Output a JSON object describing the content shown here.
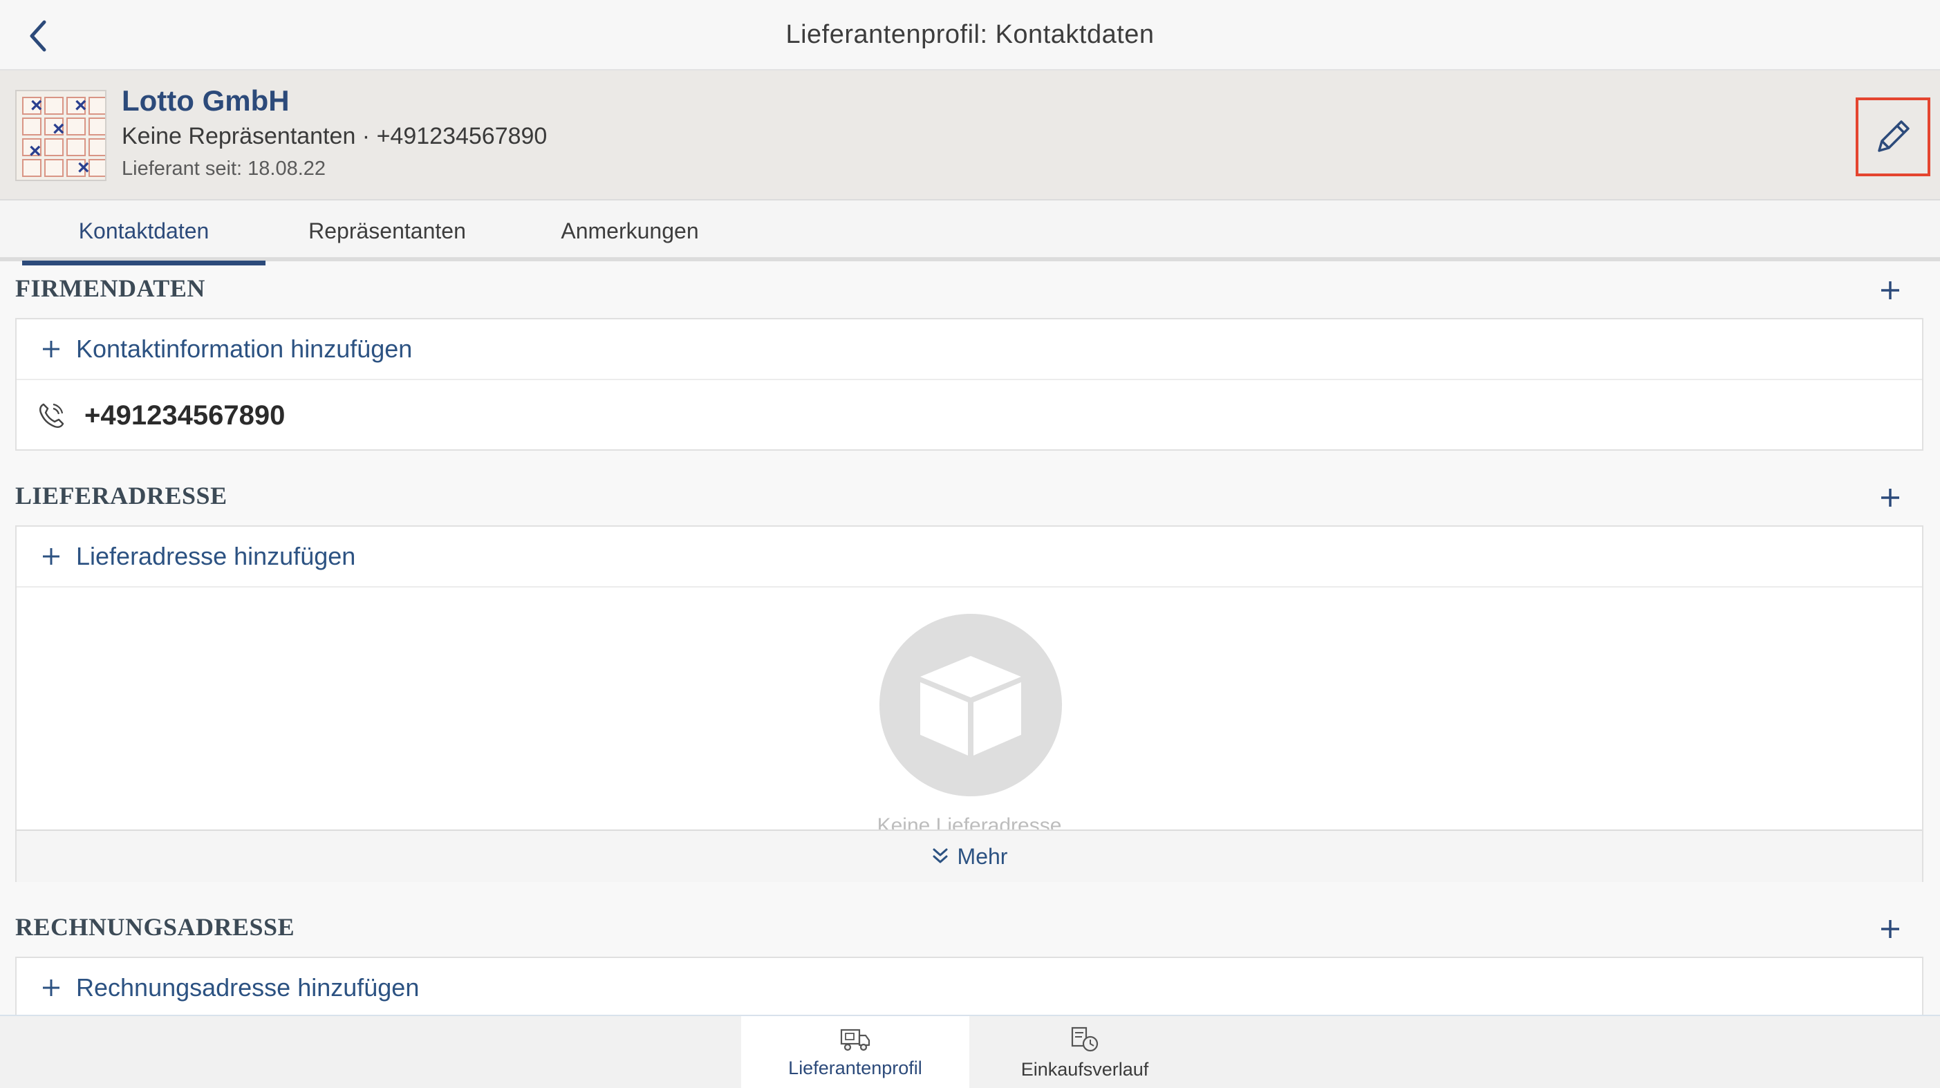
{
  "header": {
    "title": "Lieferantenprofil: Kontaktdaten",
    "back_icon": "chevron-left-icon"
  },
  "profile": {
    "name": "Lotto GmbH",
    "subtitle": "Keine Repräsentanten · +491234567890",
    "since": "Lieferant seit: 18.08.22",
    "edit_icon": "pencil-icon"
  },
  "tabs": [
    {
      "label": "Kontaktdaten",
      "active": true
    },
    {
      "label": "Repräsentanten",
      "active": false
    },
    {
      "label": "Anmerkungen",
      "active": false
    }
  ],
  "sections": {
    "firmendaten": {
      "title": "FIRMENDATEN",
      "add_label": "Kontaktinformation hinzufügen",
      "phone": "+491234567890"
    },
    "lieferadresse": {
      "title": "LIEFERADRESSE",
      "add_label": "Lieferadresse hinzufügen",
      "empty_text": "Keine Lieferadresse",
      "more_label": "Mehr"
    },
    "rechnungsadresse": {
      "title": "RECHNUNGSADRESSE",
      "add_label": "Rechnungsadresse hinzufügen"
    }
  },
  "bottom_nav": [
    {
      "label": "Lieferantenprofil",
      "icon": "supplier-truck-icon",
      "active": true
    },
    {
      "label": "Einkaufsverlauf",
      "icon": "purchase-history-icon",
      "active": false
    }
  ],
  "colors": {
    "accent": "#2c4a7a",
    "link": "#2c5282",
    "highlight_border": "#e4452f"
  }
}
